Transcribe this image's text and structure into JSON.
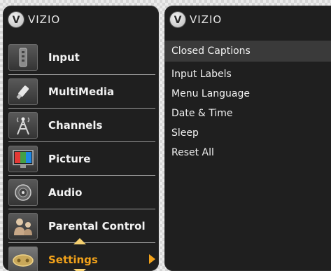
{
  "left_panel": {
    "brand": "VIZIO",
    "logo_letter": "V",
    "menu": [
      {
        "label": "Input",
        "icon": "input-icon",
        "selected": false
      },
      {
        "label": "MultiMedia",
        "icon": "usb-icon",
        "selected": false
      },
      {
        "label": "Channels",
        "icon": "antenna-icon",
        "selected": false
      },
      {
        "label": "Picture",
        "icon": "monitor-icon",
        "selected": false
      },
      {
        "label": "Audio",
        "icon": "speaker-icon",
        "selected": false
      },
      {
        "label": "Parental Control",
        "icon": "people-icon",
        "selected": false
      },
      {
        "label": "Settings",
        "icon": "controller-icon",
        "selected": true
      }
    ]
  },
  "right_panel": {
    "brand": "VIZIO",
    "logo_letter": "V",
    "items": [
      {
        "label": "Closed Captions",
        "highlighted": true
      },
      {
        "label": "Input Labels",
        "highlighted": false
      },
      {
        "label": "Menu Language",
        "highlighted": false
      },
      {
        "label": "Date & Time",
        "highlighted": false
      },
      {
        "label": "Sleep",
        "highlighted": false
      },
      {
        "label": "Reset All",
        "highlighted": false
      }
    ]
  },
  "colors": {
    "panel_bg": "#1f1f1f",
    "selected_text": "#f2a21a",
    "highlight_bg": "#3a3a3a",
    "arrow": "#f5d070"
  }
}
